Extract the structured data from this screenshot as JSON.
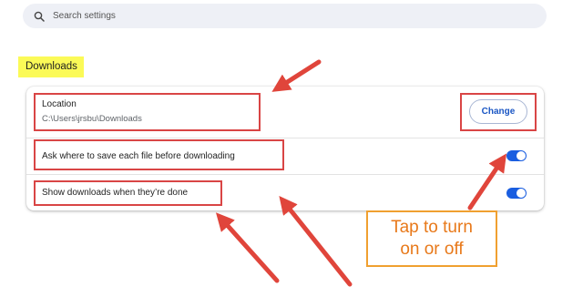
{
  "search": {
    "placeholder": "Search settings",
    "icon": "search-icon"
  },
  "section": {
    "title": "Downloads"
  },
  "settings": {
    "location": {
      "label": "Location",
      "path": "C:\\Users\\jrsbu\\Downloads",
      "button_label": "Change"
    },
    "ask_where": {
      "label": "Ask where to save each file before downloading",
      "enabled": true
    },
    "show_downloads": {
      "label": "Show downloads when they’re done",
      "enabled": true
    }
  },
  "annotation": {
    "line1": "Tap to turn",
    "line2": "on or off"
  },
  "colors": {
    "highlight_yellow": "#fbfa57",
    "annotation_red": "#d94545",
    "callout_orange": "#f0a030",
    "toggle_blue": "#1a5ee0",
    "button_text_blue": "#1a56c4"
  }
}
